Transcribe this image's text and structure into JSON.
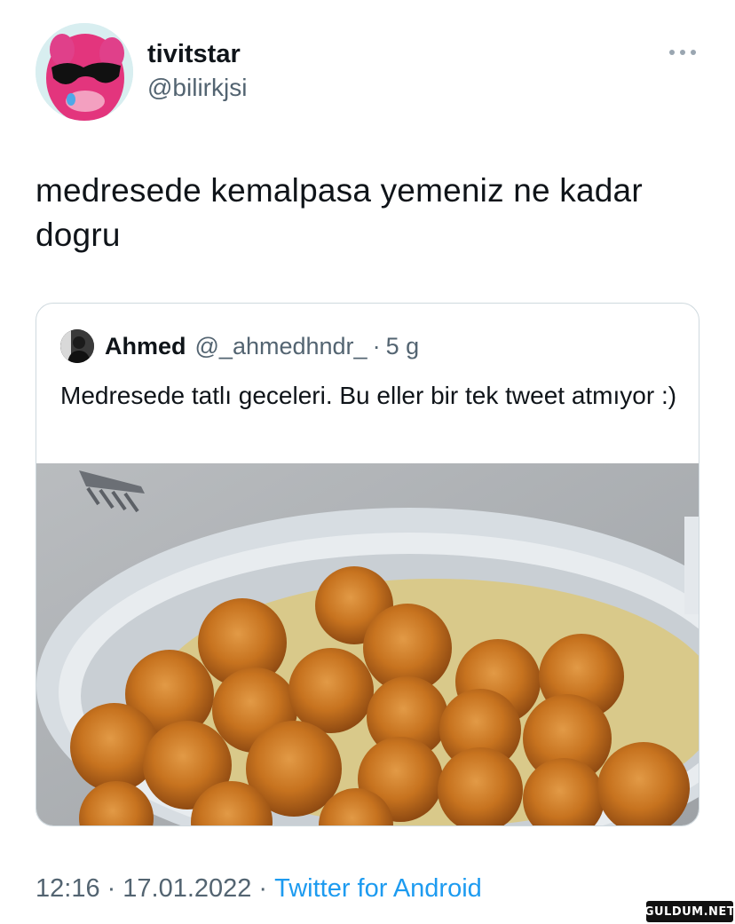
{
  "tweet": {
    "display_name": "tivitstar",
    "handle": "@bilirkjsi",
    "text": "medresede kemalpasa yemeniz ne kadar dogru",
    "more_icon": "more-horizontal-icon"
  },
  "quoted_tweet": {
    "display_name": "Ahmed",
    "handle": "@_ahmedhndr_",
    "separator": "·",
    "time": "5 g",
    "text": "Medresede tatlı geceleri. Bu eller bir tek tweet atmıyor :)"
  },
  "footer": {
    "time": "12:16",
    "date": "17.01.2022",
    "separator": "·",
    "source": "Twitter for Android"
  },
  "watermark": {
    "text": "GULDUM.NET"
  },
  "colors": {
    "text_primary": "#0f1419",
    "text_secondary": "#536471",
    "link": "#1d9bf0",
    "border": "#cfd9de"
  }
}
